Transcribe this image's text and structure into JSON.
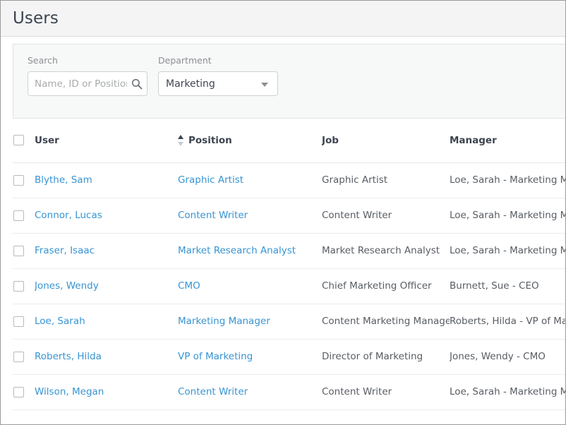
{
  "header": {
    "title": "Users"
  },
  "filters": {
    "search": {
      "label": "Search",
      "placeholder": "Name, ID or Position",
      "value": "",
      "icon": "search-icon"
    },
    "department": {
      "label": "Department",
      "selected": "Marketing",
      "icon": "chevron-down-icon"
    }
  },
  "table": {
    "columns": [
      {
        "key": "user",
        "label": "User",
        "sorted": false
      },
      {
        "key": "position",
        "label": "Position",
        "sorted": true,
        "sort_direction": "asc"
      },
      {
        "key": "job",
        "label": "Job",
        "sorted": false
      },
      {
        "key": "manager",
        "label": "Manager",
        "sorted": false
      }
    ],
    "select_all_checkbox": false,
    "rows": [
      {
        "checked": false,
        "user": "Blythe, Sam",
        "position": "Graphic Artist",
        "job": "Graphic Artist",
        "manager": "Loe, Sarah  -  Marketing Manager"
      },
      {
        "checked": false,
        "user": "Connor, Lucas",
        "position": "Content Writer",
        "job": "Content Writer",
        "manager": "Loe, Sarah  -  Marketing Manager"
      },
      {
        "checked": false,
        "user": "Fraser, Isaac",
        "position": "Market Research Analyst",
        "job": "Market Research Analyst",
        "manager": "Loe, Sarah  -  Marketing Manager"
      },
      {
        "checked": false,
        "user": "Jones, Wendy",
        "position": "CMO",
        "job": "Chief Marketing Officer",
        "manager": "Burnett, Sue  -  CEO"
      },
      {
        "checked": false,
        "user": "Loe, Sarah",
        "position": "Marketing Manager",
        "job": "Content Marketing Manager",
        "manager": "Roberts, Hilda  -  VP of Marketing"
      },
      {
        "checked": false,
        "user": "Roberts, Hilda",
        "position": "VP of Marketing",
        "job": "Director of Marketing",
        "manager": "Jones, Wendy  -  CMO"
      },
      {
        "checked": false,
        "user": "Wilson, Megan",
        "position": "Content Writer",
        "job": "Content Writer",
        "manager": "Loe, Sarah  -  Marketing Manager"
      }
    ]
  },
  "colors": {
    "link": "#3794d2",
    "heading": "#3d4450",
    "body_text": "#585d63",
    "label": "#8d8f93",
    "panel_bg": "#f7f8f8",
    "header_bg": "#f4f4f4",
    "row_border": "#ebecee"
  }
}
